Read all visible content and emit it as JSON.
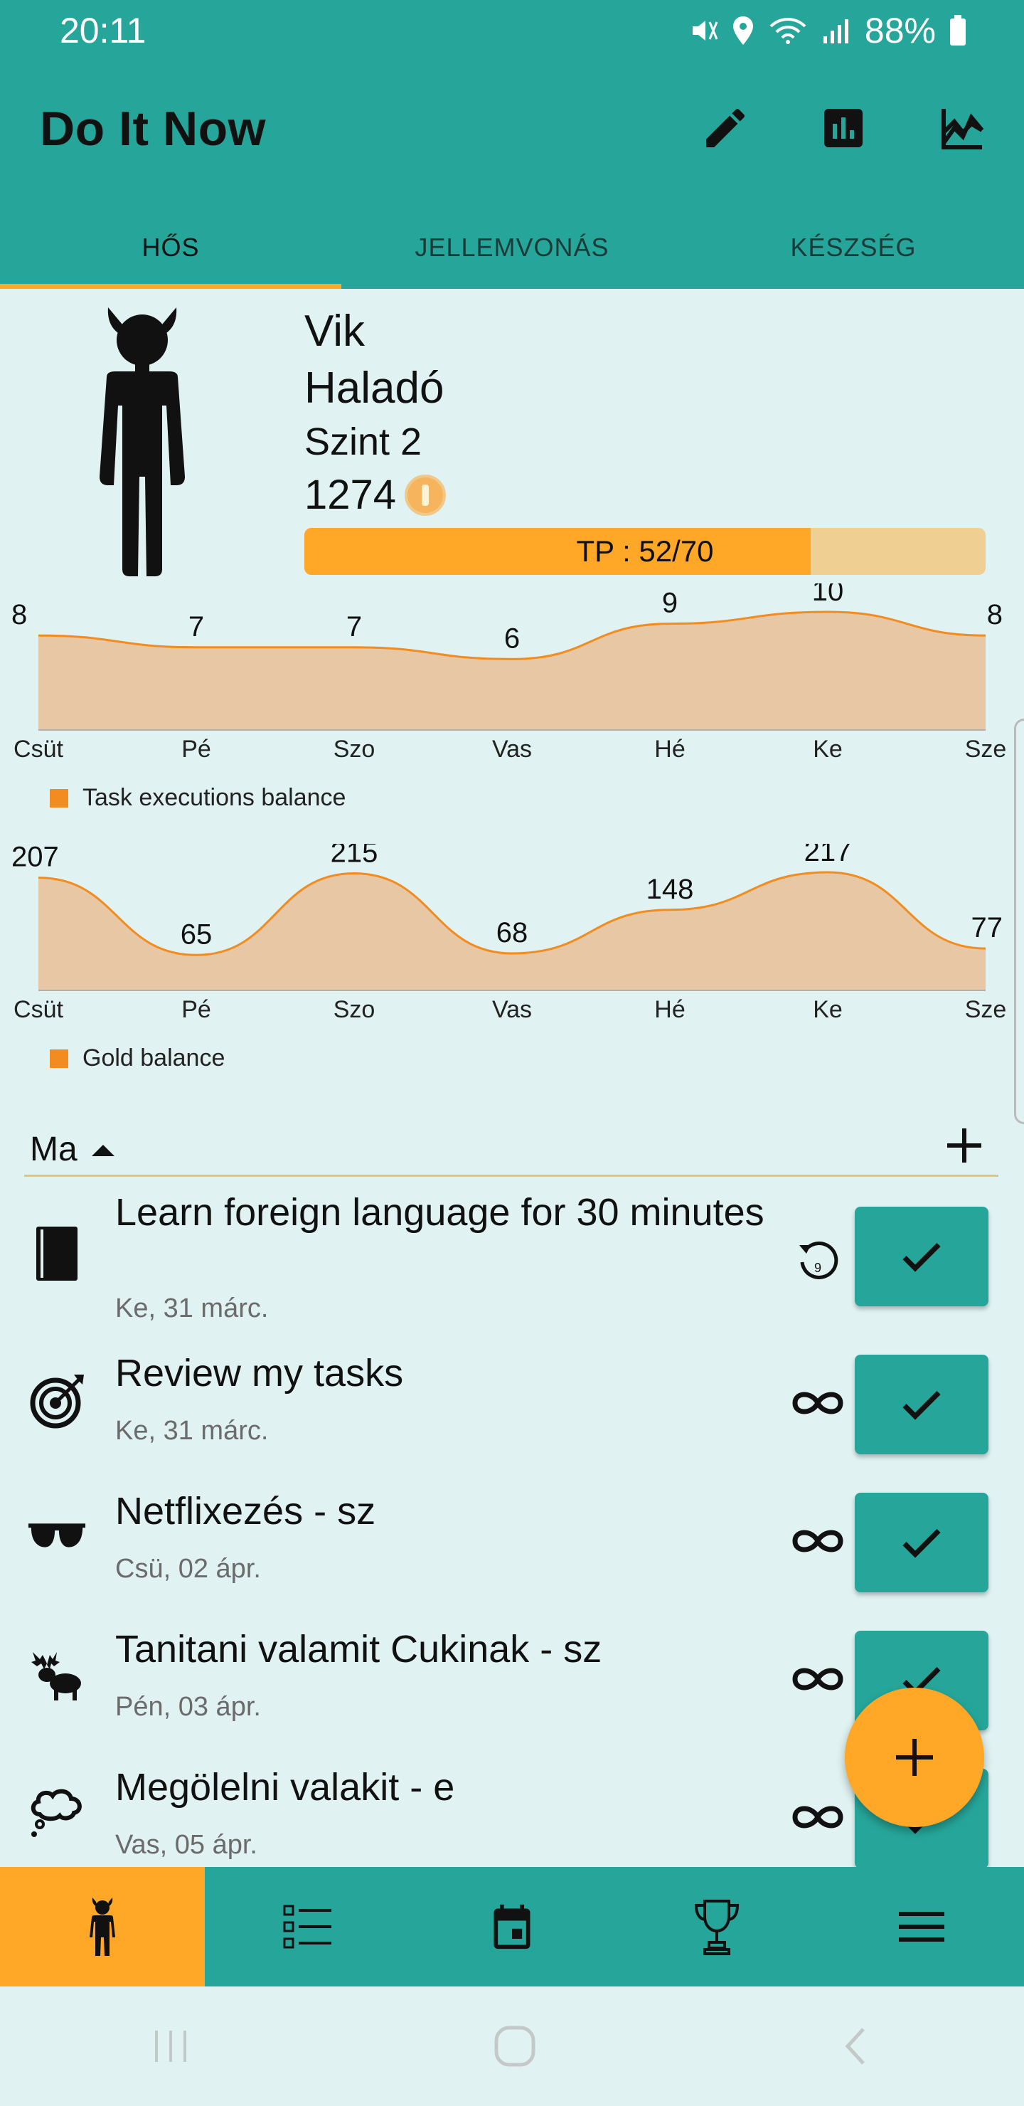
{
  "status_bar": {
    "time": "20:11",
    "battery": "88%"
  },
  "app": {
    "title": "Do It Now"
  },
  "toolbar_icons": [
    "edit-icon",
    "bar-chart-icon",
    "line-chart-icon"
  ],
  "tabs": [
    {
      "label": "HŐS",
      "active": true
    },
    {
      "label": "JELLEMVONÁS",
      "active": false
    },
    {
      "label": "KÉSZSÉG",
      "active": false
    }
  ],
  "hero": {
    "name": "Vik",
    "rank": "Haladó",
    "level": "Szint 2",
    "gold": "1274",
    "xp_text": "TP : 52/70",
    "xp_fraction": 0.7429
  },
  "colors": {
    "primary": "#26a69a",
    "accent": "#ffa726",
    "chart_line": "#f28b20",
    "chart_fill": "#e8c8a4"
  },
  "chart_data": [
    {
      "type": "area",
      "categories": [
        "Csüt",
        "Pé",
        "Szo",
        "Vas",
        "Hé",
        "Ke",
        "Sze"
      ],
      "series": [
        {
          "name": "Task executions balance",
          "values": [
            8,
            7,
            7,
            6,
            9,
            10,
            8
          ]
        }
      ],
      "ylim": [
        0,
        10
      ],
      "legend": "bottom-left"
    },
    {
      "type": "area",
      "categories": [
        "Csüt",
        "Pé",
        "Szo",
        "Vas",
        "Hé",
        "Ke",
        "Sze"
      ],
      "series": [
        {
          "name": "Gold balance",
          "values": [
            207,
            65,
            215,
            68,
            148,
            217,
            77
          ]
        }
      ],
      "ylim": [
        0,
        217
      ],
      "legend": "bottom-left"
    }
  ],
  "list": {
    "header": "Ma"
  },
  "tasks": [
    {
      "title": "Learn foreign language for 30 minutes",
      "date": "Ke, 31 márc.",
      "icon": "book-icon",
      "repeat_icon": "repeat-9-icon"
    },
    {
      "title": "Review my tasks",
      "date": "Ke, 31 márc.",
      "icon": "target-icon",
      "repeat_icon": "infinity-icon"
    },
    {
      "title": "Netflixezés - sz",
      "date": "Csü, 02 ápr.",
      "icon": "sunglasses-icon",
      "repeat_icon": "infinity-icon"
    },
    {
      "title": "Tanitani valamit Cukinak - sz",
      "date": "Pén, 03 ápr.",
      "icon": "moose-icon",
      "repeat_icon": "infinity-icon"
    },
    {
      "title": "Megölelni valakit - e",
      "date": "Vas, 05 ápr.",
      "icon": "thought-cloud-icon",
      "repeat_icon": "infinity-icon"
    }
  ],
  "bottom_nav": [
    "hero-icon",
    "list-icon",
    "calendar-icon",
    "trophy-icon",
    "menu-icon"
  ]
}
